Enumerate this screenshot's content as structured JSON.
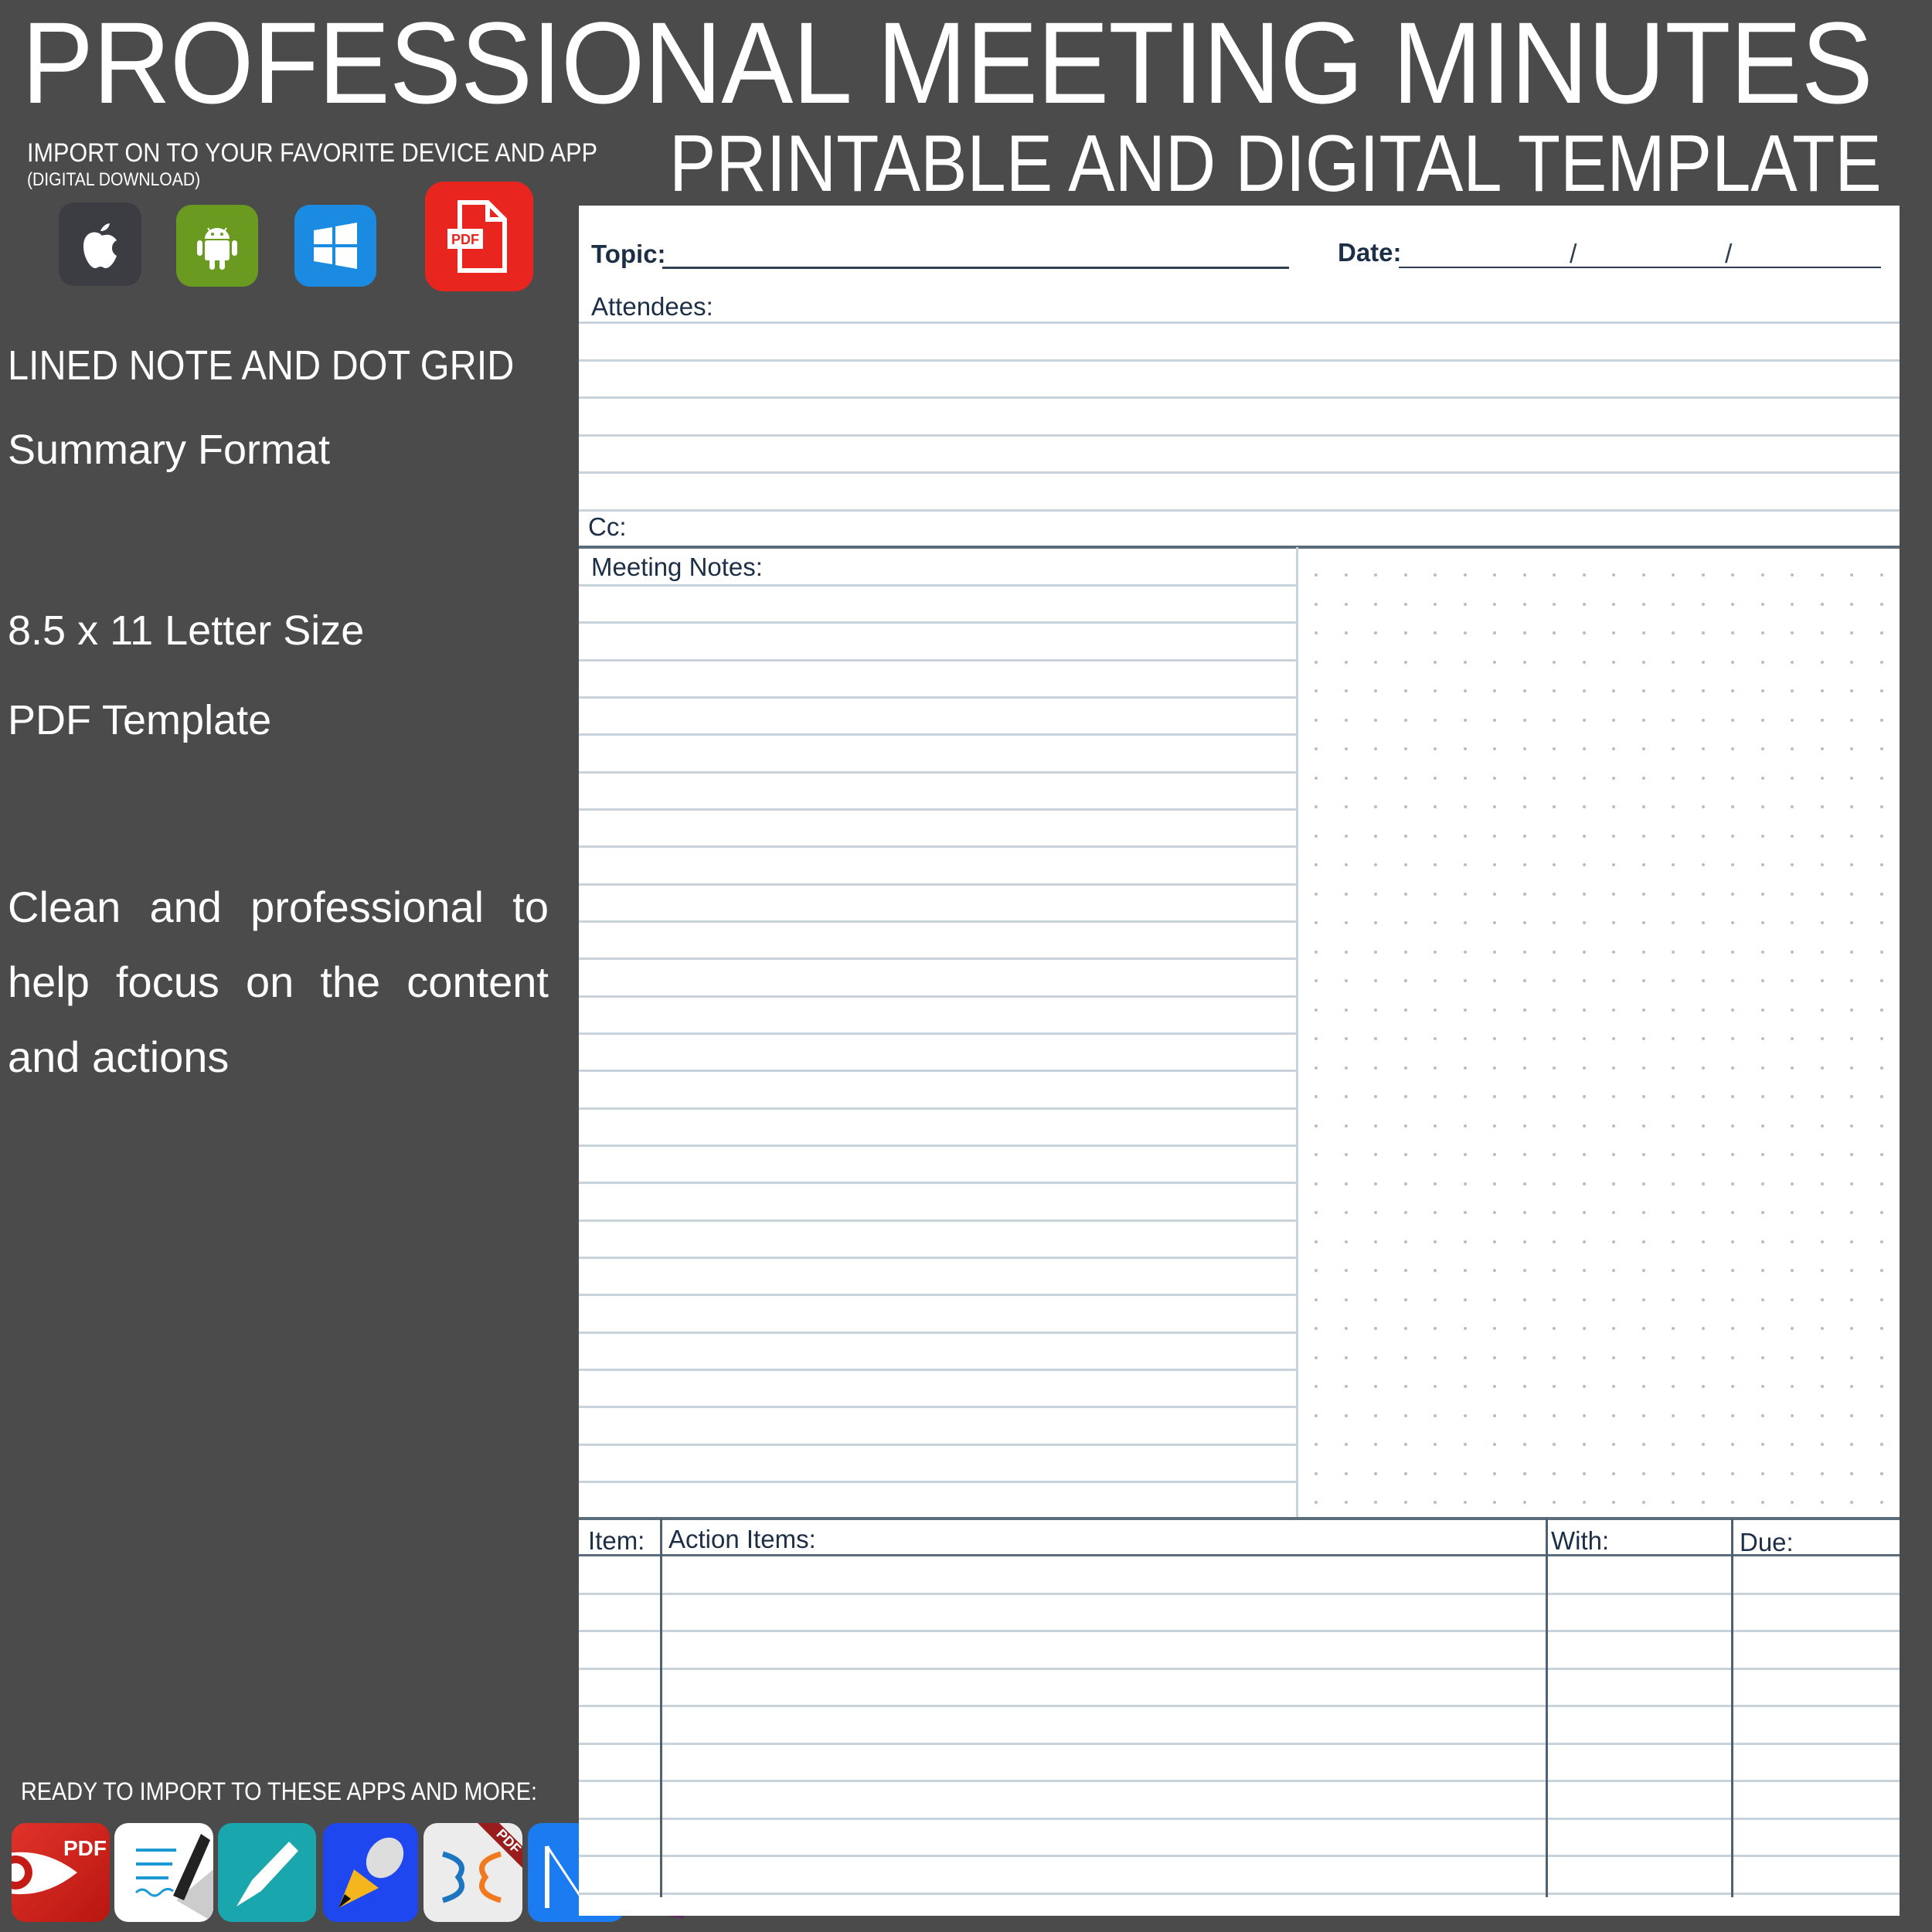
{
  "header": {
    "title": "PROFESSIONAL MEETING MINUTES",
    "subtitle": "PRINTABLE AND DIGITAL TEMPLATE",
    "import_line": "IMPORT ON TO YOUR FAVORITE DEVICE AND APP",
    "import_sub": "(DIGITAL DOWNLOAD)"
  },
  "devices": [
    {
      "name": "apple-icon",
      "color": "#3c3d42"
    },
    {
      "name": "android-icon",
      "color": "#6a9a1f"
    },
    {
      "name": "windows-icon",
      "color": "#1a8be0"
    },
    {
      "name": "pdf-icon",
      "color": "#e8251f",
      "label": "PDF"
    }
  ],
  "features": {
    "line1": "LINED NOTE AND DOT GRID",
    "line2": "Summary Format",
    "line3": "8.5 x 11 Letter Size",
    "line4": "PDF Template",
    "description": "Clean and professional to help focus on the content and actions"
  },
  "apps": {
    "heading": "READY TO IMPORT TO THESE APPS AND MORE:",
    "items": [
      {
        "name": "pdf-expert-icon",
        "label": "PDF",
        "color": "#d3221c"
      },
      {
        "name": "goodnotes-icon",
        "color": "#ffffff"
      },
      {
        "name": "noteshelf-icon",
        "color": "#1aa6ad"
      },
      {
        "name": "notability-icon",
        "color": "#1f47f0"
      },
      {
        "name": "xodo-icon",
        "label": "PDF",
        "color": "#ececec"
      },
      {
        "name": "notes-plus-icon",
        "color": "#1a7cf0"
      },
      {
        "name": "onenote-icon",
        "label": "N",
        "color": "#5d2a5b"
      }
    ]
  },
  "form": {
    "topic_label": "Topic:",
    "date_label": "Date:",
    "date_separator": "/",
    "attendees_label": "Attendees:",
    "cc_label": "Cc:",
    "notes_label": "Meeting Notes:",
    "action_headers": {
      "item": "Item:",
      "action": "Action Items:",
      "with": "With:",
      "due": "Due:"
    },
    "attendee_lines": 5,
    "notes_lines": 25,
    "action_rows": 10,
    "dot_grid": {
      "columns": 20,
      "rows": 33
    }
  },
  "colors": {
    "background": "#4b4b4b",
    "label_text": "#1d2f47",
    "rule_light": "#c9d3dc",
    "rule_dark": "#5b6c7b"
  }
}
